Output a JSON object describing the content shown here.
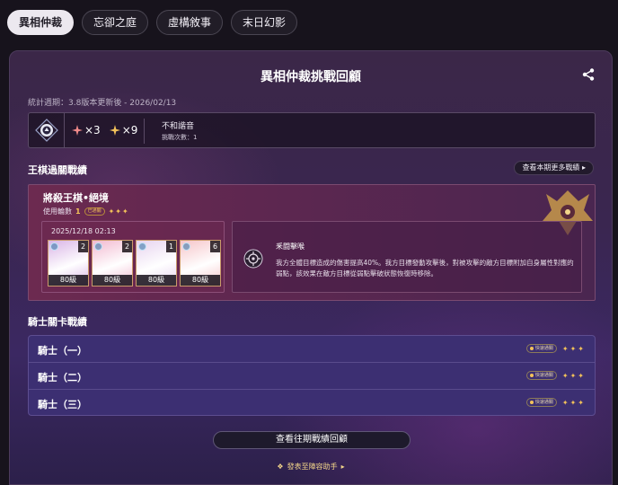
{
  "tabs": [
    "異相仲裁",
    "忘卻之庭",
    "虛構敘事",
    "末日幻影"
  ],
  "panel": {
    "title": "異相仲裁挑戰回顧",
    "stat_period": "統計週期：3.8版本更新後 - 2026/02/13"
  },
  "summary": {
    "star_counts": [
      "×3",
      "×9"
    ],
    "name": "不和諧音",
    "challenge_count": "挑戰次數：1"
  },
  "chess_section": {
    "title": "王棋過關戰績",
    "more_link": "查看本期更多戰績",
    "boss_name": "將殺王棋•絕境",
    "rounds_label": "使用輪數",
    "rounds_value": "1",
    "cleared_badge": "已通關",
    "stars": "✦✦✦",
    "date": "2025/12/18 02:13",
    "characters": [
      {
        "eidolon": "2",
        "level": "80級",
        "bg": "#d9b4e6"
      },
      {
        "eidolon": "2",
        "level": "80級",
        "bg": "#f2b9d0"
      },
      {
        "eidolon": "1",
        "level": "80級",
        "bg": "#e7d3ef"
      },
      {
        "eidolon": "6",
        "level": "80級",
        "bg": "#f6c5c9"
      }
    ],
    "buff_name": "釆闘擊喉",
    "buff_desc": "我方全體目標造成的傷害提高40%。我方目標發動攻擊後，對被攻擊的敵方目標附加自身屬性對應的弱點，該效果在敵方目標從弱點擊破狀態恢復時移除。"
  },
  "knight_section": {
    "title": "騎士關卡戰績",
    "rows": [
      {
        "name": "騎士（一）",
        "badge": "快速通關",
        "stars": "✦✦✦"
      },
      {
        "name": "騎士（二）",
        "badge": "快速通關",
        "stars": "✦✦✦"
      },
      {
        "name": "騎士（三）",
        "badge": "快速通關",
        "stars": "✦✦✦"
      }
    ]
  },
  "history_button": "查看往期戰績回顧",
  "post_link": "發表至陣容助手",
  "colors": {
    "accent": "#f3c25a",
    "panel": "#3a2650",
    "knight_list": "#3c2f72"
  }
}
